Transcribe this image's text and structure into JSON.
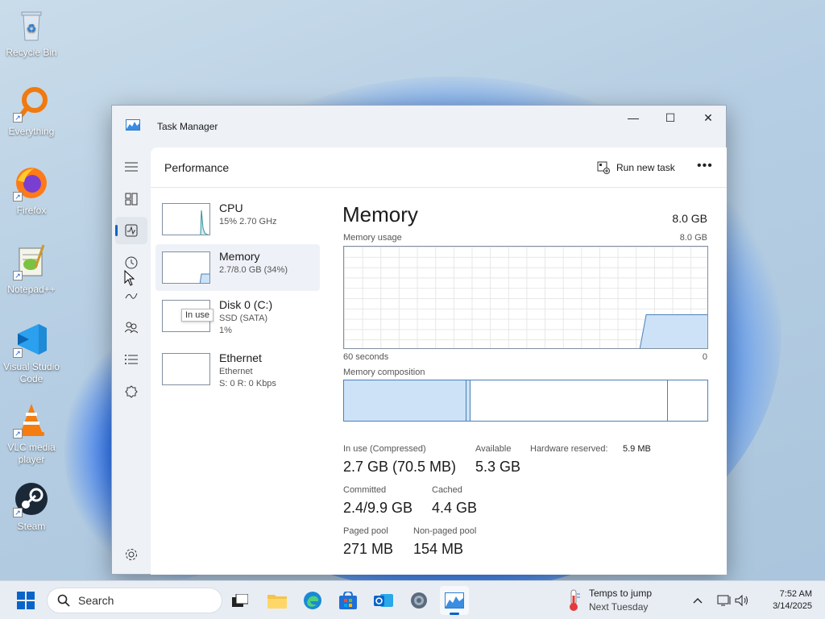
{
  "desktop": {
    "icons": [
      {
        "label": "Recycle Bin"
      },
      {
        "label": "Everything"
      },
      {
        "label": "Firefox"
      },
      {
        "label": "Notepad++"
      },
      {
        "label": "Visual Studio Code"
      },
      {
        "label": "VLC media player"
      },
      {
        "label": "Steam"
      }
    ]
  },
  "window": {
    "title": "Task Manager",
    "controls": {
      "minimize": "—",
      "maximize": "☐",
      "close": "✕"
    }
  },
  "nav": {
    "items": [
      "menu-icon",
      "processes-icon",
      "performance-icon",
      "app-history-icon",
      "startup-apps-icon",
      "users-icon",
      "details-icon",
      "services-icon",
      "settings-icon"
    ]
  },
  "header": {
    "page_title": "Performance",
    "run_new_task": "Run new task",
    "more": "•••"
  },
  "resources": [
    {
      "name": "CPU",
      "line1": "15%  2.70 GHz",
      "line2": ""
    },
    {
      "name": "Memory",
      "line1": "2.7/8.0 GB (34%)",
      "line2": ""
    },
    {
      "name": "Disk 0 (C:)",
      "line1": "SSD (SATA)",
      "line2": "1%"
    },
    {
      "name": "Ethernet",
      "line1": "Ethernet",
      "line2": "S: 0  R: 0 Kbps"
    }
  ],
  "tooltip": "In use",
  "memory": {
    "title": "Memory",
    "total": "8.0 GB",
    "usage_label": "Memory usage",
    "usage_max": "8.0 GB",
    "graph_left": "60 seconds",
    "graph_right": "0",
    "composition_label": "Memory composition",
    "usage_fraction": 0.34,
    "stats": {
      "in_use_label": "In use (Compressed)",
      "in_use_value": "2.7 GB (70.5 MB)",
      "available_label": "Available",
      "available_value": "5.3 GB",
      "hw_reserved_label": "Hardware reserved:",
      "hw_reserved_value": "5.9 MB",
      "committed_label": "Committed",
      "committed_value": "2.4/9.9 GB",
      "cached_label": "Cached",
      "cached_value": "4.4 GB",
      "paged_label": "Paged pool",
      "paged_value": "271 MB",
      "nonpaged_label": "Non-paged pool",
      "nonpaged_value": "154 MB"
    }
  },
  "taskbar": {
    "search_placeholder": "Search",
    "weather_line1": "Temps to jump",
    "weather_line2": "Next Tuesday",
    "time": "7:52 AM",
    "date": "3/14/2025"
  },
  "colors": {
    "accent": "#0a64c8",
    "memory_fill": "#cde2f7",
    "memory_border": "#4a80b8"
  }
}
